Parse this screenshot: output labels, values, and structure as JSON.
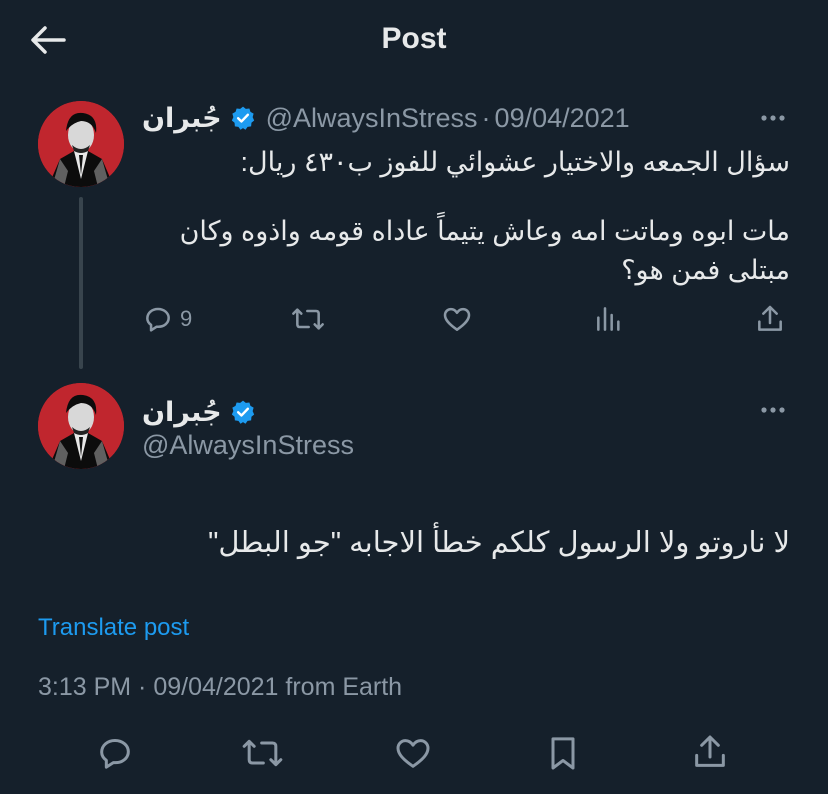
{
  "header": {
    "title": "Post"
  },
  "colors": {
    "background": "#15202b",
    "text": "#e7e9ea",
    "muted": "#8b98a5",
    "link": "#1d9bf0",
    "verified": "#1d9bf0"
  },
  "parent_post": {
    "display_name": "جُبران",
    "handle": "@AlwaysInStress",
    "separator": "·",
    "date": "09/04/2021",
    "text_line1": "سؤال الجمعه والاختيار عشوائي للفوز ب٤٣٠ ريال:",
    "text_line2": "مات ابوه وماتت امه وعاش يتيماً عاداه قومه واذوه وكان",
    "text_line3": "مبتلى فمن هو؟",
    "reply_count": "9",
    "icons": [
      "reply-icon",
      "retweet-icon",
      "like-icon",
      "views-icon",
      "share-icon"
    ]
  },
  "main_post": {
    "display_name": "جُبران",
    "handle": "@AlwaysInStress",
    "text": "لا ناروتو ولا الرسول كلكم خطأ الاجابه \"جو البطل\"",
    "translate_label": "Translate post",
    "meta": "3:13 PM · 09/04/2021 from Earth",
    "icons": [
      "reply-icon",
      "retweet-icon",
      "like-icon",
      "bookmark-icon",
      "share-icon"
    ]
  }
}
